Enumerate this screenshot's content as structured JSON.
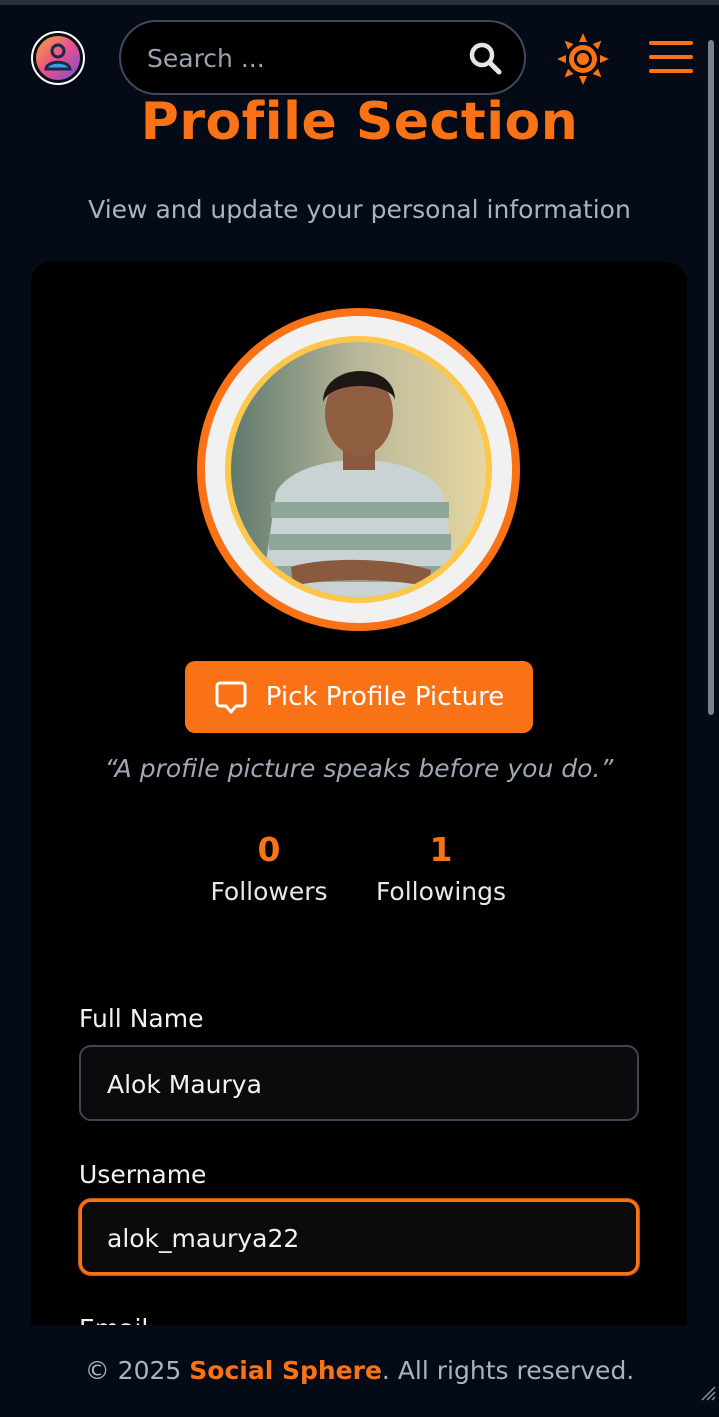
{
  "header": {
    "search_placeholder": "Search ...",
    "icons": [
      "app-logo-icon",
      "search-icon",
      "sun-icon",
      "menu-icon"
    ]
  },
  "page": {
    "title": "Profile Section",
    "subtitle": "View and update your personal information"
  },
  "profile": {
    "pick_picture_label": "Pick Profile Picture",
    "quote": "“A profile picture speaks before you do.”",
    "stats": [
      {
        "value": "0",
        "label": "Followers"
      },
      {
        "value": "1",
        "label": "Followings"
      }
    ]
  },
  "form": {
    "full_name_label": "Full Name",
    "full_name_value": "Alok Maurya",
    "username_label": "Username",
    "username_value": "alok_maurya22",
    "email_label": "Email"
  },
  "footer": {
    "prefix": "© 2025 ",
    "brand": "Social Sphere",
    "suffix": ". All rights reserved."
  },
  "colors": {
    "accent": "#f97316",
    "background": "#050b16",
    "card": "#000000",
    "muted_text": "#a8b3c2"
  }
}
